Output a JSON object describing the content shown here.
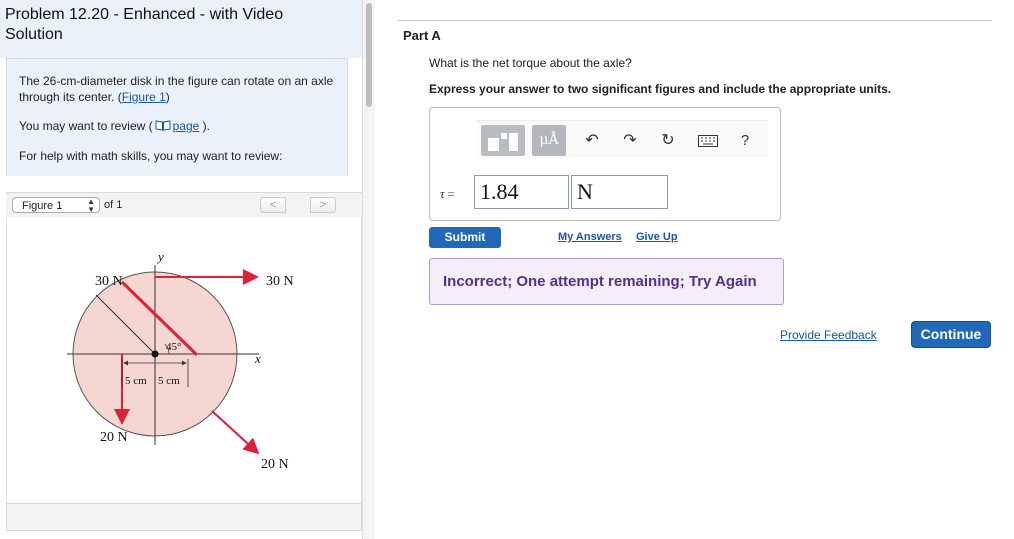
{
  "problem": {
    "title": "Problem 12.20 - Enhanced - with Video Solution",
    "description_text": "The 26-cm-diameter disk in the figure can rotate on an axle through its center. (",
    "figure_link": "Figure 1",
    "description_close": ")",
    "review_prefix": "You may want to review (",
    "review_link": "page",
    "review_suffix": ").",
    "math_help": "For help with math skills, you may want to review:"
  },
  "figure_nav": {
    "selected": "Figure 1",
    "of_text": "of 1",
    "prev": "<",
    "next": ">"
  },
  "figure": {
    "force_top_left": "30 N",
    "force_top_right": "30 N",
    "force_bottom_left": "20 N",
    "force_bottom_right": "20 N",
    "axis_y": "y",
    "axis_x": "x",
    "angle": "45°",
    "dim_left": "5 cm",
    "dim_right": "5 cm",
    "colors": {
      "disk": "#f6d6d0",
      "arrow": "#e0203a"
    }
  },
  "part": {
    "label": "Part A",
    "question": "What is the net torque about the axle?",
    "instruction": "Express your answer to two significant figures and include the appropriate units.",
    "tau_symbol": "τ",
    "equals": "=",
    "answer_value": "1.84",
    "answer_unit": "N",
    "units_button": "μÅ",
    "help_glyph": "?"
  },
  "actions": {
    "submit": "Submit",
    "my_answers": "My Answers",
    "give_up": "Give Up",
    "feedback": "Incorrect; One attempt remaining; Try Again",
    "provide_feedback": "Provide Feedback",
    "continue": "Continue"
  },
  "icons": {
    "book": "book-icon",
    "template": "template-icon",
    "undo": "undo-icon",
    "redo": "redo-icon",
    "reset": "reset-icon",
    "keyboard": "keyboard-icon",
    "help": "help-icon"
  },
  "colors": {
    "primary_button": "#2168b8",
    "link": "#1a55a6",
    "feedback_bg": "#f4eef8",
    "feedback_text": "#55308a"
  }
}
